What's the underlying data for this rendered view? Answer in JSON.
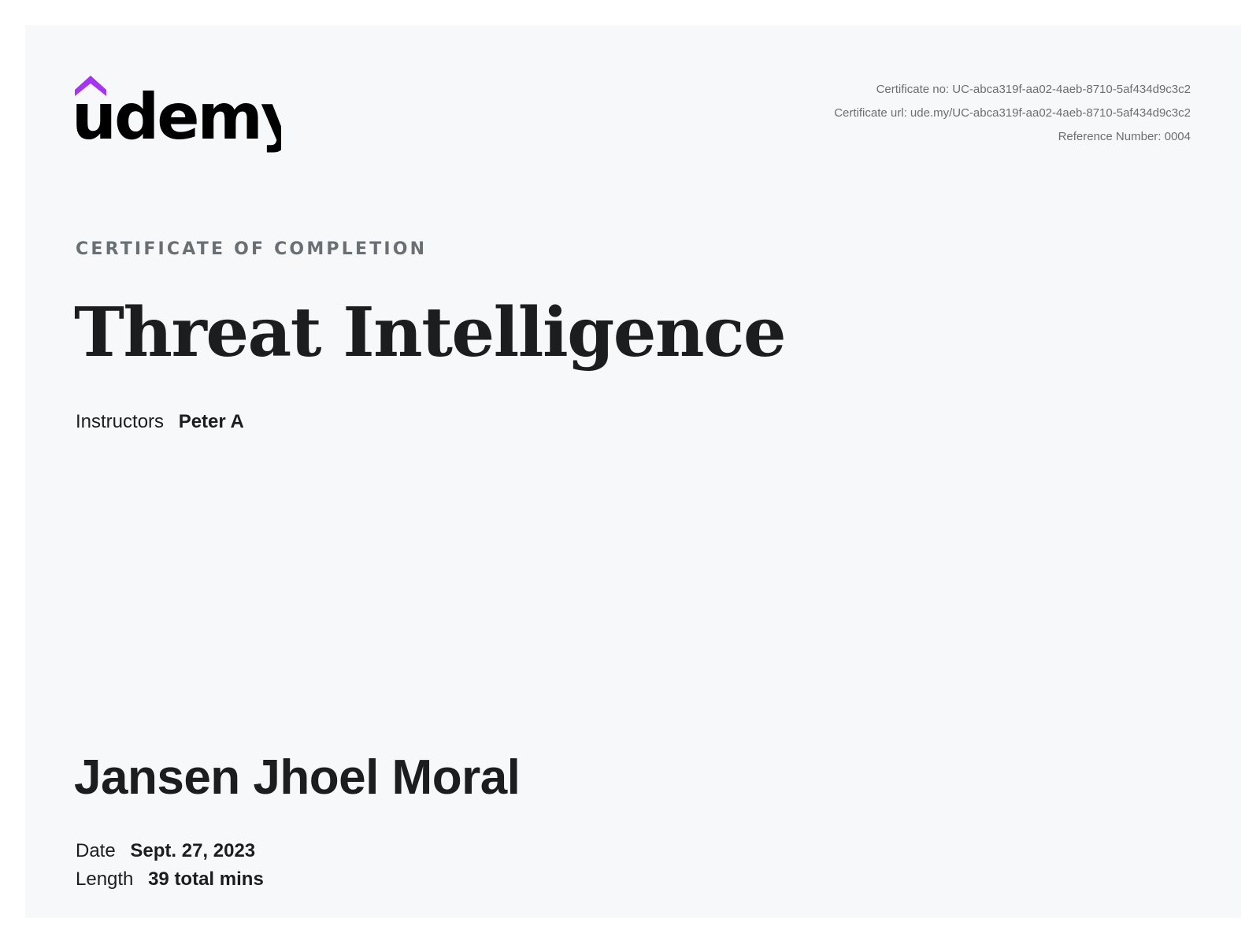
{
  "brand": {
    "logo_text": "udemy",
    "accent_color": "#a435f0"
  },
  "meta": {
    "certificate_no": "Certificate no: UC-abca319f-aa02-4aeb-8710-5af434d9c3c2",
    "certificate_url": "Certificate url: ude.my/UC-abca319f-aa02-4aeb-8710-5af434d9c3c2",
    "reference_number": "Reference Number: 0004"
  },
  "certificate": {
    "eyebrow": "CERTIFICATE OF COMPLETION",
    "course_title": "Threat Intelligence",
    "instructors_label": "Instructors",
    "instructors_value": "Peter A",
    "recipient_name": "Jansen Jhoel Moral",
    "date_label": "Date",
    "date_value": "Sept. 27, 2023",
    "length_label": "Length",
    "length_value": "39 total mins"
  }
}
